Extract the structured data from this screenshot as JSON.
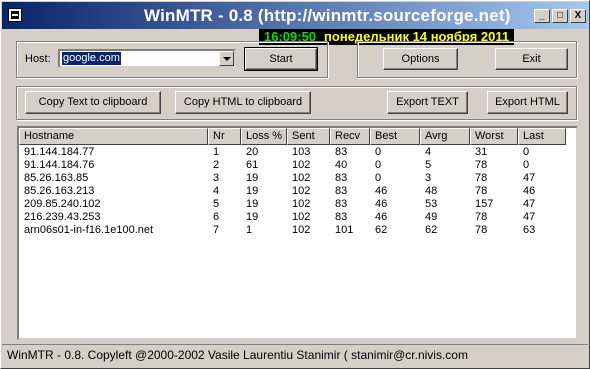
{
  "window": {
    "title": "WinMTR - 0.8 (http://winmtr.sourceforge.net)",
    "controls": {
      "minimize": "_",
      "maximize": "□",
      "close": "X"
    }
  },
  "clock": {
    "time": "16:09:50",
    "date": "понедельник 14 ноября 2011"
  },
  "host": {
    "label": "Host:",
    "value": "google.com"
  },
  "buttons": {
    "start": "Start",
    "options": "Options",
    "exit": "Exit",
    "copy_text": "Copy Text to clipboard",
    "copy_html": "Copy HTML to clipboard",
    "export_text": "Export TEXT",
    "export_html": "Export HTML"
  },
  "table": {
    "columns": [
      "Hostname",
      "Nr",
      "Loss %",
      "Sent",
      "Recv",
      "Best",
      "Avrg",
      "Worst",
      "Last"
    ],
    "rows": [
      [
        "91.144.184.77",
        "1",
        "20",
        "103",
        "83",
        "0",
        "4",
        "31",
        "0"
      ],
      [
        "91.144.184.76",
        "2",
        "61",
        "102",
        "40",
        "0",
        "5",
        "78",
        "0"
      ],
      [
        "85.26.163.85",
        "3",
        "19",
        "102",
        "83",
        "0",
        "3",
        "78",
        "47"
      ],
      [
        "85.26.163.213",
        "4",
        "19",
        "102",
        "83",
        "46",
        "48",
        "78",
        "46"
      ],
      [
        "209.85.240.102",
        "5",
        "19",
        "102",
        "83",
        "46",
        "53",
        "157",
        "47"
      ],
      [
        "216.239.43.253",
        "6",
        "19",
        "102",
        "83",
        "46",
        "49",
        "78",
        "47"
      ],
      [
        "arn06s01-in-f16.1e100.net",
        "7",
        "1",
        "102",
        "101",
        "62",
        "62",
        "78",
        "63"
      ]
    ]
  },
  "statusbar": {
    "text": "WinMTR - 0.8. Copyleft @2000-2002 Vasile Laurentiu Stanimir  ( stanimir@cr.nivis.com"
  }
}
